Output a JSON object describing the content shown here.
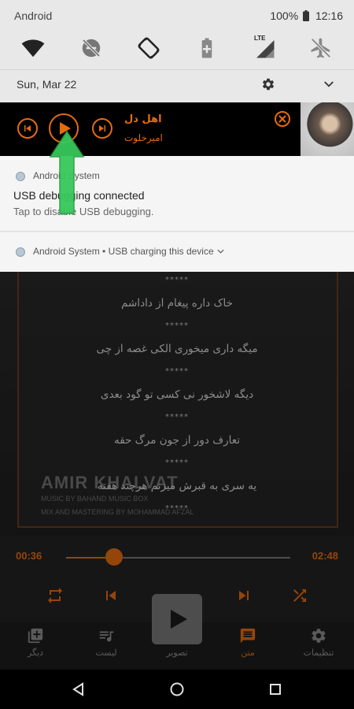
{
  "status_bar": {
    "title": "Android",
    "battery_percent": "100%",
    "time": "12:16"
  },
  "quick_settings": {
    "icons": [
      "wifi-icon",
      "dnd-off-icon",
      "auto-rotate-icon",
      "battery-saver-icon",
      "cellular-lte-icon",
      "airplane-mode-icon"
    ],
    "lte_label": "LTE"
  },
  "date_row": {
    "date": "Sun, Mar 22"
  },
  "media_notification": {
    "title": "اهل دل",
    "artist": "امیرخلوت",
    "accent_color": "#e56b10"
  },
  "usb_notification": {
    "app_name": "Android System",
    "title": "USB debugging connected",
    "text": "Tap to disable USB debugging."
  },
  "charging_notification": {
    "text": "Android System • USB charging this device"
  },
  "lyrics": {
    "separator": "*****",
    "lines": [
      "خاک داره پیغام از داداشم",
      "میگه داری میخوری الکی غصه از چی",
      "دیگه لاشخور نی کسی تو گود بعدی",
      "تعارف دور از جون مرگ حقه",
      "یه سری به قبرش میزنم هرچند هفته"
    ]
  },
  "album": {
    "title": "AMIR KHALVAT",
    "credit_1": "MUSIC BY BAHAND MUSIC BOX",
    "credit_2": "MIX AND MASTERING BY MOHAMMAD AFZAL"
  },
  "player": {
    "elapsed": "00:36",
    "duration": "02:48",
    "progress_fraction": 0.214
  },
  "tabs": [
    {
      "label": "دیگر",
      "icon": "folder-icon",
      "active": false
    },
    {
      "label": "لیست",
      "icon": "playlist-icon",
      "active": false
    },
    {
      "label": "تصویر",
      "icon": "image-icon",
      "active": false
    },
    {
      "label": "متن",
      "icon": "message-icon",
      "active": true
    },
    {
      "label": "تنظیمات",
      "icon": "gear-icon",
      "active": false
    }
  ],
  "annotation": {
    "arrow_color": "#37c85a"
  }
}
